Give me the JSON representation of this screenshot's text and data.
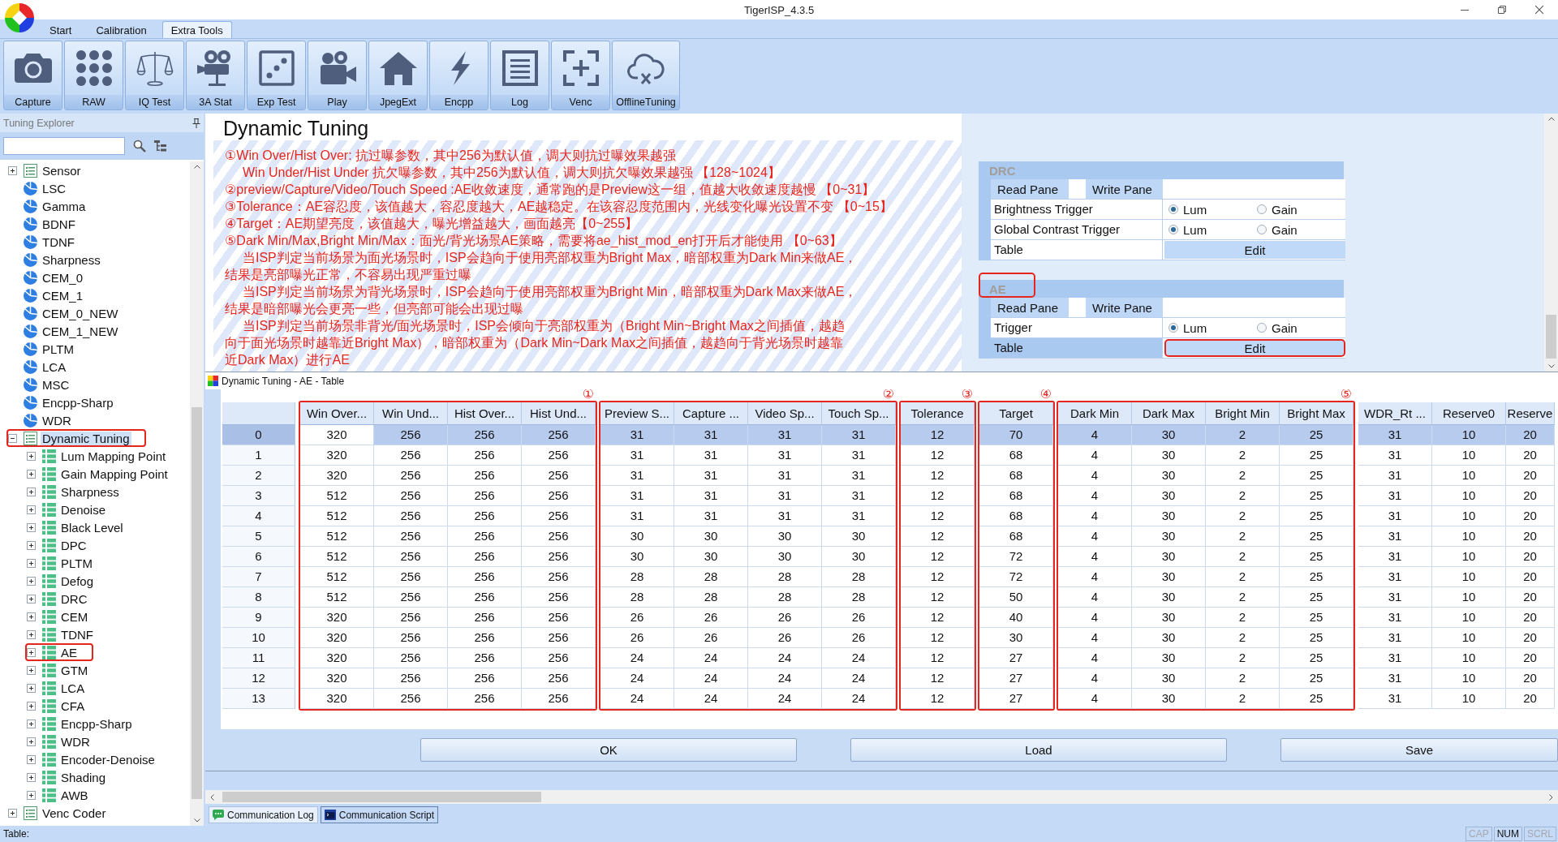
{
  "window": {
    "title": "TigerISP_4.3.5"
  },
  "ribbon": {
    "tabs": [
      {
        "label": "Start",
        "selected": false
      },
      {
        "label": "Calibration",
        "selected": false
      },
      {
        "label": "Extra Tools",
        "selected": true
      }
    ],
    "buttons": [
      "Capture",
      "RAW",
      "IQ Test",
      "3A Stat",
      "Exp Test",
      "Play",
      "JpegExt",
      "Encpp",
      "Log",
      "Venc",
      "OfflineTuning"
    ]
  },
  "explorer": {
    "title": "Tuning Explorer",
    "tree": [
      {
        "label": "Sensor",
        "kind": "group",
        "expanded": false,
        "selected": false,
        "outlined": false
      },
      {
        "label": "LSC",
        "kind": "leaf",
        "selected": false,
        "outlined": false
      },
      {
        "label": "Gamma",
        "kind": "leaf",
        "selected": false,
        "outlined": false
      },
      {
        "label": "BDNF",
        "kind": "leaf",
        "selected": false,
        "outlined": false
      },
      {
        "label": "TDNF",
        "kind": "leaf",
        "selected": false,
        "outlined": false
      },
      {
        "label": "Sharpness",
        "kind": "leaf",
        "selected": false,
        "outlined": false
      },
      {
        "label": "CEM_0",
        "kind": "leaf",
        "selected": false,
        "outlined": false
      },
      {
        "label": "CEM_1",
        "kind": "leaf",
        "selected": false,
        "outlined": false
      },
      {
        "label": "CEM_0_NEW",
        "kind": "leaf",
        "selected": false,
        "outlined": false
      },
      {
        "label": "CEM_1_NEW",
        "kind": "leaf",
        "selected": false,
        "outlined": false
      },
      {
        "label": "PLTM",
        "kind": "leaf",
        "selected": false,
        "outlined": false
      },
      {
        "label": "LCA",
        "kind": "leaf",
        "selected": false,
        "outlined": false
      },
      {
        "label": "MSC",
        "kind": "leaf",
        "selected": false,
        "outlined": false
      },
      {
        "label": "Encpp-Sharp",
        "kind": "leaf",
        "selected": false,
        "outlined": false
      },
      {
        "label": "WDR",
        "kind": "leaf",
        "selected": false,
        "outlined": false
      },
      {
        "label": "Dynamic Tuning",
        "kind": "group",
        "expanded": true,
        "selected": true,
        "outlined": true,
        "children": [
          {
            "label": "Lum Mapping Point",
            "kind": "grid",
            "expanded": false,
            "selected": false,
            "outlined": false
          },
          {
            "label": "Gain Mapping Point",
            "kind": "grid",
            "expanded": false,
            "selected": false,
            "outlined": false
          },
          {
            "label": "Sharpness",
            "kind": "grid",
            "expanded": false,
            "selected": false,
            "outlined": false
          },
          {
            "label": "Denoise",
            "kind": "grid",
            "expanded": false,
            "selected": false,
            "outlined": false
          },
          {
            "label": "Black Level",
            "kind": "grid",
            "expanded": false,
            "selected": false,
            "outlined": false
          },
          {
            "label": "DPC",
            "kind": "grid",
            "expanded": false,
            "selected": false,
            "outlined": false
          },
          {
            "label": "PLTM",
            "kind": "grid",
            "expanded": false,
            "selected": false,
            "outlined": false
          },
          {
            "label": "Defog",
            "kind": "grid",
            "expanded": false,
            "selected": false,
            "outlined": false
          },
          {
            "label": "DRC",
            "kind": "grid",
            "expanded": false,
            "selected": false,
            "outlined": false
          },
          {
            "label": "CEM",
            "kind": "grid",
            "expanded": false,
            "selected": false,
            "outlined": false
          },
          {
            "label": "TDNF",
            "kind": "grid",
            "expanded": false,
            "selected": false,
            "outlined": false
          },
          {
            "label": "AE",
            "kind": "grid",
            "expanded": false,
            "selected": false,
            "outlined": true
          },
          {
            "label": "GTM",
            "kind": "grid",
            "expanded": false,
            "selected": false,
            "outlined": false
          },
          {
            "label": "LCA",
            "kind": "grid",
            "expanded": false,
            "selected": false,
            "outlined": false
          },
          {
            "label": "CFA",
            "kind": "grid",
            "expanded": false,
            "selected": false,
            "outlined": false
          },
          {
            "label": "Encpp-Sharp",
            "kind": "grid",
            "expanded": false,
            "selected": false,
            "outlined": false
          },
          {
            "label": "WDR",
            "kind": "grid",
            "expanded": false,
            "selected": false,
            "outlined": false
          },
          {
            "label": "Encoder-Denoise",
            "kind": "grid",
            "expanded": false,
            "selected": false,
            "outlined": false
          },
          {
            "label": "Shading",
            "kind": "grid",
            "expanded": false,
            "selected": false,
            "outlined": false
          },
          {
            "label": "AWB",
            "kind": "grid",
            "expanded": false,
            "selected": false,
            "outlined": false
          }
        ]
      },
      {
        "label": "Venc Coder",
        "kind": "group",
        "expanded": false,
        "selected": false,
        "outlined": false
      }
    ]
  },
  "document": {
    "title": "Dynamic Tuning",
    "notes": [
      {
        "text": "①Win Over/Hist Over: 抗过曝参数，其中256为默认值，调大则抗过曝效果越强",
        "indent": false
      },
      {
        "text": "Win Under/Hist Under 抗欠曝参数，其中256为默认值，调大则抗欠曝效果越强 【128~1024】",
        "indent": true
      },
      {
        "text": "②preview/Capture/Video/Touch Speed :AE收敛速度，通常跑的是Preview这一组，值越大收敛速度越慢 【0~31】",
        "indent": false
      },
      {
        "text": "③Tolerance：AE容忍度，该值越大，容忍度越大，AE越稳定。在该容忍度范围内，光线变化曝光设置不变 【0~15】",
        "indent": false
      },
      {
        "text": "④Target：AE期望亮度，该值越大，曝光增益越大，画面越亮【0~255】",
        "indent": false
      },
      {
        "text": "⑤Dark Min/Max,Bright Min/Max：面光/背光场景AE策略，需要将ae_hist_mod_en打开后才能使用 【0~63】",
        "indent": false
      },
      {
        "text": "当ISP判定当前场景为面光场景时，ISP会趋向于使用亮部权重为Bright Max，暗部权重为Dark Min来做AE，",
        "indent": true
      },
      {
        "text": "结果是亮部曝光正常，不容易出现严重过曝",
        "indent": false
      },
      {
        "text": "当ISP判定当前场景为背光场景时，ISP会趋向于使用亮部权重为Bright Min，暗部权重为Dark Max来做AE，",
        "indent": true
      },
      {
        "text": "结果是暗部曝光会更亮一些，但亮部可能会出现过曝",
        "indent": false
      },
      {
        "text": "当ISP判定当前场景非背光/面光场景时，ISP会倾向于亮部权重为（Bright Min~Bright Max之间插值，越趋",
        "indent": true
      },
      {
        "text": "向于面光场景时越靠近Bright Max），暗部权重为（Dark Min~Dark Max之间插值，越趋向于背光场景时越靠",
        "indent": false
      },
      {
        "text": "近Dark Max）进行AE",
        "indent": false
      }
    ],
    "panels": [
      {
        "title": "DRC",
        "outlined": false,
        "panes": [
          "Read Pane",
          "Write Pane"
        ],
        "rows": [
          {
            "kind": "radio",
            "label": "Brightness Trigger",
            "selected": false,
            "options": [
              {
                "label": "Lum",
                "selected": true
              },
              {
                "label": "Gain",
                "selected": false
              }
            ]
          },
          {
            "kind": "radio",
            "label": "Global Contrast Trigger",
            "selected": false,
            "options": [
              {
                "label": "Lum",
                "selected": true
              },
              {
                "label": "Gain",
                "selected": false
              }
            ]
          },
          {
            "kind": "button",
            "label": "Table",
            "selected": false,
            "button": {
              "label": "Edit",
              "outlined": false
            }
          }
        ]
      },
      {
        "title": "AE",
        "outlined": true,
        "panes": [
          "Read Pane",
          "Write Pane"
        ],
        "rows": [
          {
            "kind": "radio",
            "label": "Trigger",
            "selected": false,
            "options": [
              {
                "label": "Lum",
                "selected": true
              },
              {
                "label": "Gain",
                "selected": false
              }
            ]
          },
          {
            "kind": "button",
            "label": "Table",
            "selected": true,
            "button": {
              "label": "Edit",
              "outlined": true
            }
          }
        ]
      }
    ]
  },
  "table_window": {
    "title": "Dynamic Tuning - AE - Table",
    "table": {
      "column_groups": [
        {
          "marker": "①",
          "outlined": true,
          "columns": [
            {
              "label": "Win Over...",
              "current": true
            },
            {
              "label": "Win Und...",
              "current": false
            },
            {
              "label": "Hist Over...",
              "current": false
            },
            {
              "label": "Hist Und...",
              "current": false
            }
          ]
        },
        {
          "marker": "②",
          "outlined": true,
          "columns": [
            {
              "label": "Preview S...",
              "current": false
            },
            {
              "label": "Capture ...",
              "current": false
            },
            {
              "label": "Video Sp...",
              "current": false
            },
            {
              "label": "Touch Sp...",
              "current": false
            }
          ]
        },
        {
          "marker": "③",
          "outlined": true,
          "columns": [
            {
              "label": "Tolerance",
              "current": false
            }
          ]
        },
        {
          "marker": "④",
          "outlined": true,
          "columns": [
            {
              "label": "Target",
              "current": false
            }
          ]
        },
        {
          "marker": "⑤",
          "outlined": true,
          "columns": [
            {
              "label": "Dark Min",
              "current": false
            },
            {
              "label": "Dark Max",
              "current": false
            },
            {
              "label": "Bright Min",
              "current": false
            },
            {
              "label": "Bright Max",
              "current": false
            }
          ]
        },
        {
          "outlined": false,
          "columns": [
            {
              "label": "WDR_Rt ...",
              "current": false
            },
            {
              "label": "Reserve0",
              "current": false
            },
            {
              "label": "Reserve",
              "current": false
            }
          ]
        }
      ],
      "rows": [
        {
          "label": "0",
          "selected": true,
          "cells": [
            "320",
            "256",
            "256",
            "256",
            "31",
            "31",
            "31",
            "31",
            "12",
            "70",
            "4",
            "30",
            "2",
            "25",
            "31",
            "10",
            "20"
          ]
        },
        {
          "label": "1",
          "selected": false,
          "cells": [
            "320",
            "256",
            "256",
            "256",
            "31",
            "31",
            "31",
            "31",
            "12",
            "68",
            "4",
            "30",
            "2",
            "25",
            "31",
            "10",
            "20"
          ]
        },
        {
          "label": "2",
          "selected": false,
          "cells": [
            "320",
            "256",
            "256",
            "256",
            "31",
            "31",
            "31",
            "31",
            "12",
            "68",
            "4",
            "30",
            "2",
            "25",
            "31",
            "10",
            "20"
          ]
        },
        {
          "label": "3",
          "selected": false,
          "cells": [
            "512",
            "256",
            "256",
            "256",
            "31",
            "31",
            "31",
            "31",
            "12",
            "68",
            "4",
            "30",
            "2",
            "25",
            "31",
            "10",
            "20"
          ]
        },
        {
          "label": "4",
          "selected": false,
          "cells": [
            "512",
            "256",
            "256",
            "256",
            "31",
            "31",
            "31",
            "31",
            "12",
            "68",
            "4",
            "30",
            "2",
            "25",
            "31",
            "10",
            "20"
          ]
        },
        {
          "label": "5",
          "selected": false,
          "cells": [
            "512",
            "256",
            "256",
            "256",
            "30",
            "30",
            "30",
            "30",
            "12",
            "68",
            "4",
            "30",
            "2",
            "25",
            "31",
            "10",
            "20"
          ]
        },
        {
          "label": "6",
          "selected": false,
          "cells": [
            "512",
            "256",
            "256",
            "256",
            "30",
            "30",
            "30",
            "30",
            "12",
            "72",
            "4",
            "30",
            "2",
            "25",
            "31",
            "10",
            "20"
          ]
        },
        {
          "label": "7",
          "selected": false,
          "cells": [
            "512",
            "256",
            "256",
            "256",
            "28",
            "28",
            "28",
            "28",
            "12",
            "72",
            "4",
            "30",
            "2",
            "25",
            "31",
            "10",
            "20"
          ]
        },
        {
          "label": "8",
          "selected": false,
          "cells": [
            "512",
            "256",
            "256",
            "256",
            "28",
            "28",
            "28",
            "28",
            "12",
            "50",
            "4",
            "30",
            "2",
            "25",
            "31",
            "10",
            "20"
          ]
        },
        {
          "label": "9",
          "selected": false,
          "cells": [
            "320",
            "256",
            "256",
            "256",
            "26",
            "26",
            "26",
            "26",
            "12",
            "40",
            "4",
            "30",
            "2",
            "25",
            "31",
            "10",
            "20"
          ]
        },
        {
          "label": "10",
          "selected": false,
          "cells": [
            "320",
            "256",
            "256",
            "256",
            "26",
            "26",
            "26",
            "26",
            "12",
            "30",
            "4",
            "30",
            "2",
            "25",
            "31",
            "10",
            "20"
          ]
        },
        {
          "label": "11",
          "selected": false,
          "cells": [
            "320",
            "256",
            "256",
            "256",
            "24",
            "24",
            "24",
            "24",
            "12",
            "27",
            "4",
            "30",
            "2",
            "25",
            "31",
            "10",
            "20"
          ]
        },
        {
          "label": "12",
          "selected": false,
          "cells": [
            "320",
            "256",
            "256",
            "256",
            "24",
            "24",
            "24",
            "24",
            "12",
            "27",
            "4",
            "30",
            "2",
            "25",
            "31",
            "10",
            "20"
          ]
        },
        {
          "label": "13",
          "selected": false,
          "cells": [
            "320",
            "256",
            "256",
            "256",
            "24",
            "24",
            "24",
            "24",
            "12",
            "27",
            "4",
            "30",
            "2",
            "25",
            "31",
            "10",
            "20"
          ]
        }
      ]
    },
    "buttons": [
      "OK",
      "Load",
      "Save"
    ]
  },
  "bottom_tabs": [
    {
      "label": "Communication Log",
      "kind": "chat",
      "selected": false
    },
    {
      "label": "Communication Script",
      "kind": "console",
      "selected": true
    }
  ],
  "status_bar": {
    "text": "Table:",
    "indicators": [
      {
        "label": "CAP",
        "on": false
      },
      {
        "label": "NUM",
        "on": true
      },
      {
        "label": "SCRL",
        "on": false
      }
    ]
  }
}
